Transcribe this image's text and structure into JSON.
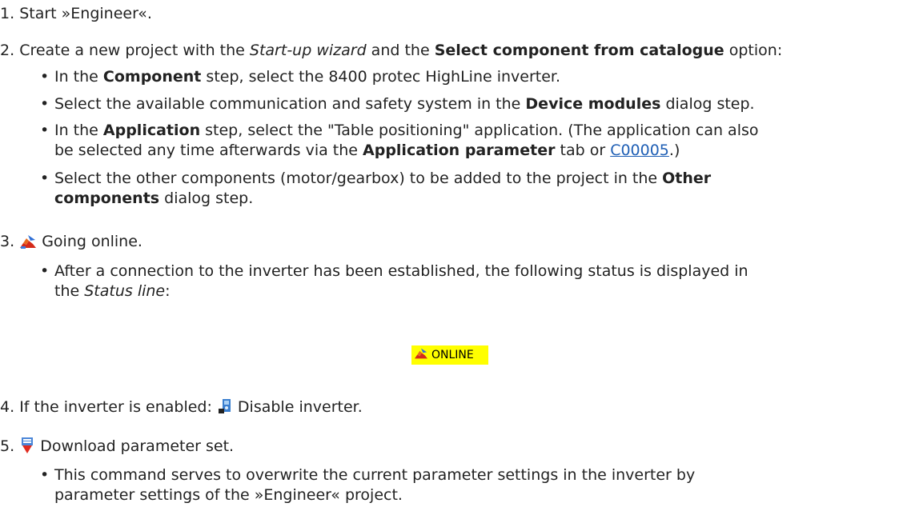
{
  "steps": [
    {
      "num": "1.",
      "p1": "Start »Engineer«."
    },
    {
      "num": "2.",
      "p1": "Create a new project with the ",
      "p2": "Start-up wizard",
      "p3": " and the ",
      "p4": "Select component from catalogue",
      "p5": " option:",
      "bullets": [
        {
          "p1": "In the ",
          "p2": "Component",
          "p3": " step, select the 8400 protec HighLine inverter."
        },
        {
          "p1": "Select the available communication and safety system in the ",
          "p2": "Device modules",
          "p3": " dialog step."
        },
        {
          "l1p1": "In the ",
          "l1p2": "Application",
          "l1p3": " step, select the \"Table positioning\" application. (The application can also",
          "l2p1": "be selected any time afterwards via the ",
          "l2p2": "Application parameter",
          "l2p3": " tab or ",
          "link": "C00005",
          "l2p4": ".)"
        },
        {
          "l1p1": "Select the other components (motor/gearbox) to be added to the project in the ",
          "l1p2": "Other",
          "l2p1": "components",
          "l2p2": " dialog step."
        }
      ]
    },
    {
      "num": "3.",
      "icon": "going-online-icon",
      "p1": "Going online.",
      "bullets": [
        {
          "l1p1": "After a connection to the inverter has been established, the following status is displayed in",
          "l2p1": "the ",
          "l2p2": "Status line",
          "l2p3": ":"
        }
      ],
      "status_badge": {
        "icon": "online-status-icon",
        "text": "ONLINE",
        "bg": "#ffff00"
      }
    },
    {
      "num": "4.",
      "p1": "If the inverter is enabled: ",
      "icon": "disable-inverter-icon",
      "p2": "Disable inverter."
    },
    {
      "num": "5.",
      "icon": "download-parameter-set-icon",
      "p1": "Download parameter set.",
      "bullets": [
        {
          "l1p1": "This command serves to overwrite the current parameter settings in the inverter by",
          "l2p1": "parameter settings of the »Engineer« project."
        }
      ]
    }
  ],
  "colors": {
    "link": "#1f5fb5",
    "text": "#222222",
    "status_bg": "#ffff00"
  }
}
